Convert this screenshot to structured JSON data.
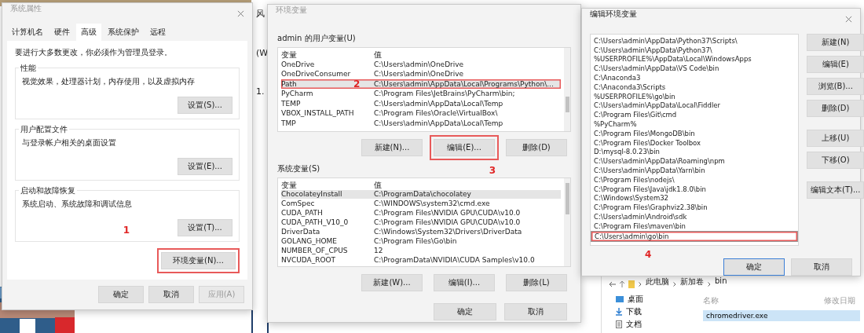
{
  "background_window": {
    "lines": [
      "风",
      "(W",
      "1."
    ]
  },
  "system_properties": {
    "title": "系统属性",
    "tabs": [
      {
        "label": "计算机名",
        "selected": false
      },
      {
        "label": "硬件",
        "selected": false
      },
      {
        "label": "高级",
        "selected": true
      },
      {
        "label": "系统保护",
        "selected": false
      },
      {
        "label": "远程",
        "selected": false
      }
    ],
    "note": "要进行大多数更改，你必须作为管理员登录。",
    "groups": [
      {
        "title": "性能",
        "description": "视觉效果，处理器计划，内存使用，以及虚拟内存",
        "button": "设置(S)..."
      },
      {
        "title": "用户配置文件",
        "description": "与登录帐户相关的桌面设置",
        "button": "设置(E)..."
      },
      {
        "title": "启动和故障恢复",
        "description": "系统启动、系统故障和调试信息",
        "button": "设置(T)..."
      }
    ],
    "env_button": {
      "label": "环境变量(N)...",
      "highlighted": true,
      "annotation": "1"
    },
    "buttons": [
      {
        "label": "确定",
        "disabled": false
      },
      {
        "label": "取消",
        "disabled": false
      },
      {
        "label": "应用(A)",
        "disabled": true
      }
    ]
  },
  "environment_variables": {
    "title": "环境变量",
    "sections": [
      {
        "title": "admin 的用户变量(U)",
        "columns": [
          "变量",
          "值"
        ],
        "rows": [
          {
            "name": "OneDrive",
            "value": "C:\\Users\\admin\\OneDrive",
            "selected": false,
            "highlighted": false
          },
          {
            "name": "OneDriveConsumer",
            "value": "C:\\Users\\admin\\OneDrive",
            "selected": false,
            "highlighted": false
          },
          {
            "name": "Path",
            "value": "C:\\Users\\admin\\AppData\\Local\\Programs\\Python\\...",
            "selected": true,
            "highlighted": true,
            "annotation": "2"
          },
          {
            "name": "PyCharm",
            "value": "C:\\Program Files\\JetBrains\\PyCharm\\bin;",
            "selected": false,
            "highlighted": false
          },
          {
            "name": "TEMP",
            "value": "C:\\Users\\admin\\AppData\\Local\\Temp",
            "selected": false,
            "highlighted": false
          },
          {
            "name": "VBOX_INSTALL_PATH",
            "value": "C:\\Program Files\\Oracle\\VirtualBox\\",
            "selected": false,
            "highlighted": false
          },
          {
            "name": "TMP",
            "value": "C:\\Users\\admin\\AppData\\Local\\Temp",
            "selected": false,
            "highlighted": false
          }
        ],
        "buttons": [
          {
            "label": "新建(N)...",
            "highlighted": false
          },
          {
            "label": "编辑(E)...",
            "highlighted": true,
            "annotation": "3"
          },
          {
            "label": "删除(D)",
            "highlighted": false
          }
        ]
      },
      {
        "title": "系统变量(S)",
        "columns": [
          "变量",
          "值"
        ],
        "rows": [
          {
            "name": "ChocolateyInstall",
            "value": "C:\\ProgramData\\chocolatey",
            "selected": true,
            "highlighted": false
          },
          {
            "name": "ComSpec",
            "value": "C:\\WINDOWS\\system32\\cmd.exe",
            "selected": false,
            "highlighted": false
          },
          {
            "name": "CUDA_PATH",
            "value": "C:\\Program Files\\NVIDIA GPU\\CUDA\\v10.0",
            "selected": false,
            "highlighted": false
          },
          {
            "name": "CUDA_PATH_V10_0",
            "value": "C:\\Program Files\\NVIDIA GPU\\CUDA\\v10.0",
            "selected": false,
            "highlighted": false
          },
          {
            "name": "DriverData",
            "value": "C:\\Windows\\System32\\Drivers\\DriverData",
            "selected": false,
            "highlighted": false
          },
          {
            "name": "GOLANG_HOME",
            "value": "C:\\Program Files\\Go\\bin",
            "selected": false,
            "highlighted": false
          },
          {
            "name": "NUMBER_OF_CPUS",
            "value": "12",
            "selected": false,
            "highlighted": false
          },
          {
            "name": "NVCUDA_ROOT",
            "value": "C:\\ProgramData\\NVIDIA\\CUDA Samples\\v10.0",
            "selected": false,
            "highlighted": false
          }
        ],
        "buttons": [
          {
            "label": "新建(W)...",
            "highlighted": false
          },
          {
            "label": "编辑(I)...",
            "highlighted": false
          },
          {
            "label": "删除(L)",
            "highlighted": false
          }
        ]
      }
    ],
    "buttons": [
      {
        "label": "确定"
      },
      {
        "label": "取消"
      }
    ]
  },
  "edit_variable": {
    "title": "编辑环境变量",
    "entries": [
      {
        "value": "C:\\Users\\admin\\AppData\\Python37\\Scripts\\",
        "selected": false,
        "highlighted": false
      },
      {
        "value": "C:\\Users\\admin\\AppData\\Python37\\",
        "selected": false,
        "highlighted": false
      },
      {
        "value": "%USERPROFILE%\\AppData\\Local\\WindowsApps",
        "selected": false,
        "highlighted": false
      },
      {
        "value": "C:\\Users\\admin\\AppData\\VS Code\\bin",
        "selected": false,
        "highlighted": false
      },
      {
        "value": "C:\\Anaconda3",
        "selected": false,
        "highlighted": false
      },
      {
        "value": "C:\\Anaconda3\\Scripts",
        "selected": false,
        "highlighted": false
      },
      {
        "value": "%USERPROFILE%\\go\\bin",
        "selected": false,
        "highlighted": false
      },
      {
        "value": "C:\\Users\\admin\\AppData\\Local\\Fiddler",
        "selected": false,
        "highlighted": false
      },
      {
        "value": "C:\\Program Files\\Git\\cmd",
        "selected": false,
        "highlighted": false
      },
      {
        "value": "%PyCharm%",
        "selected": false,
        "highlighted": false
      },
      {
        "value": "C:\\Program Files\\MongoDB\\bin",
        "selected": false,
        "highlighted": false
      },
      {
        "value": "C:\\Program Files\\Docker Toolbox",
        "selected": false,
        "highlighted": false
      },
      {
        "value": "D:\\mysql-8.0.23\\bin",
        "selected": false,
        "highlighted": false
      },
      {
        "value": "C:\\Users\\admin\\AppData\\Roaming\\npm",
        "selected": false,
        "highlighted": false
      },
      {
        "value": "C:\\Users\\admin\\AppData\\Yarn\\bin",
        "selected": false,
        "highlighted": false
      },
      {
        "value": "C:\\Program Files\\nodejs\\",
        "selected": false,
        "highlighted": false
      },
      {
        "value": "C:\\Program Files\\Java\\jdk1.8.0\\bin",
        "selected": false,
        "highlighted": false
      },
      {
        "value": "C:\\Windows\\System32",
        "selected": false,
        "highlighted": false
      },
      {
        "value": "C:\\Program Files\\Graphviz2.38\\bin",
        "selected": false,
        "highlighted": false
      },
      {
        "value": "C:\\Users\\admin\\Android\\sdk",
        "selected": false,
        "highlighted": false
      },
      {
        "value": "C:\\Program Files\\maven\\bin",
        "selected": false,
        "highlighted": false
      },
      {
        "value": "C:\\Users\\admin\\go\\bin",
        "selected": true,
        "highlighted": true,
        "annotation": "4"
      }
    ],
    "side_buttons": [
      "新建(N)",
      "编辑(E)",
      "浏览(B)...",
      "删除(D)",
      "上移(U)",
      "下移(O)",
      "编辑文本(T)..."
    ],
    "buttons": [
      {
        "label": "确定",
        "default": true
      },
      {
        "label": "取消",
        "default": false
      }
    ]
  },
  "explorer": {
    "path": [
      "此电脑",
      "新加卷",
      "bin"
    ],
    "sidebar": [
      "桌面",
      "下载",
      "文档"
    ],
    "columns": [
      "名称",
      "修改日期"
    ],
    "files": [
      {
        "name": "chromedriver.exe",
        "selected": true
      }
    ]
  }
}
